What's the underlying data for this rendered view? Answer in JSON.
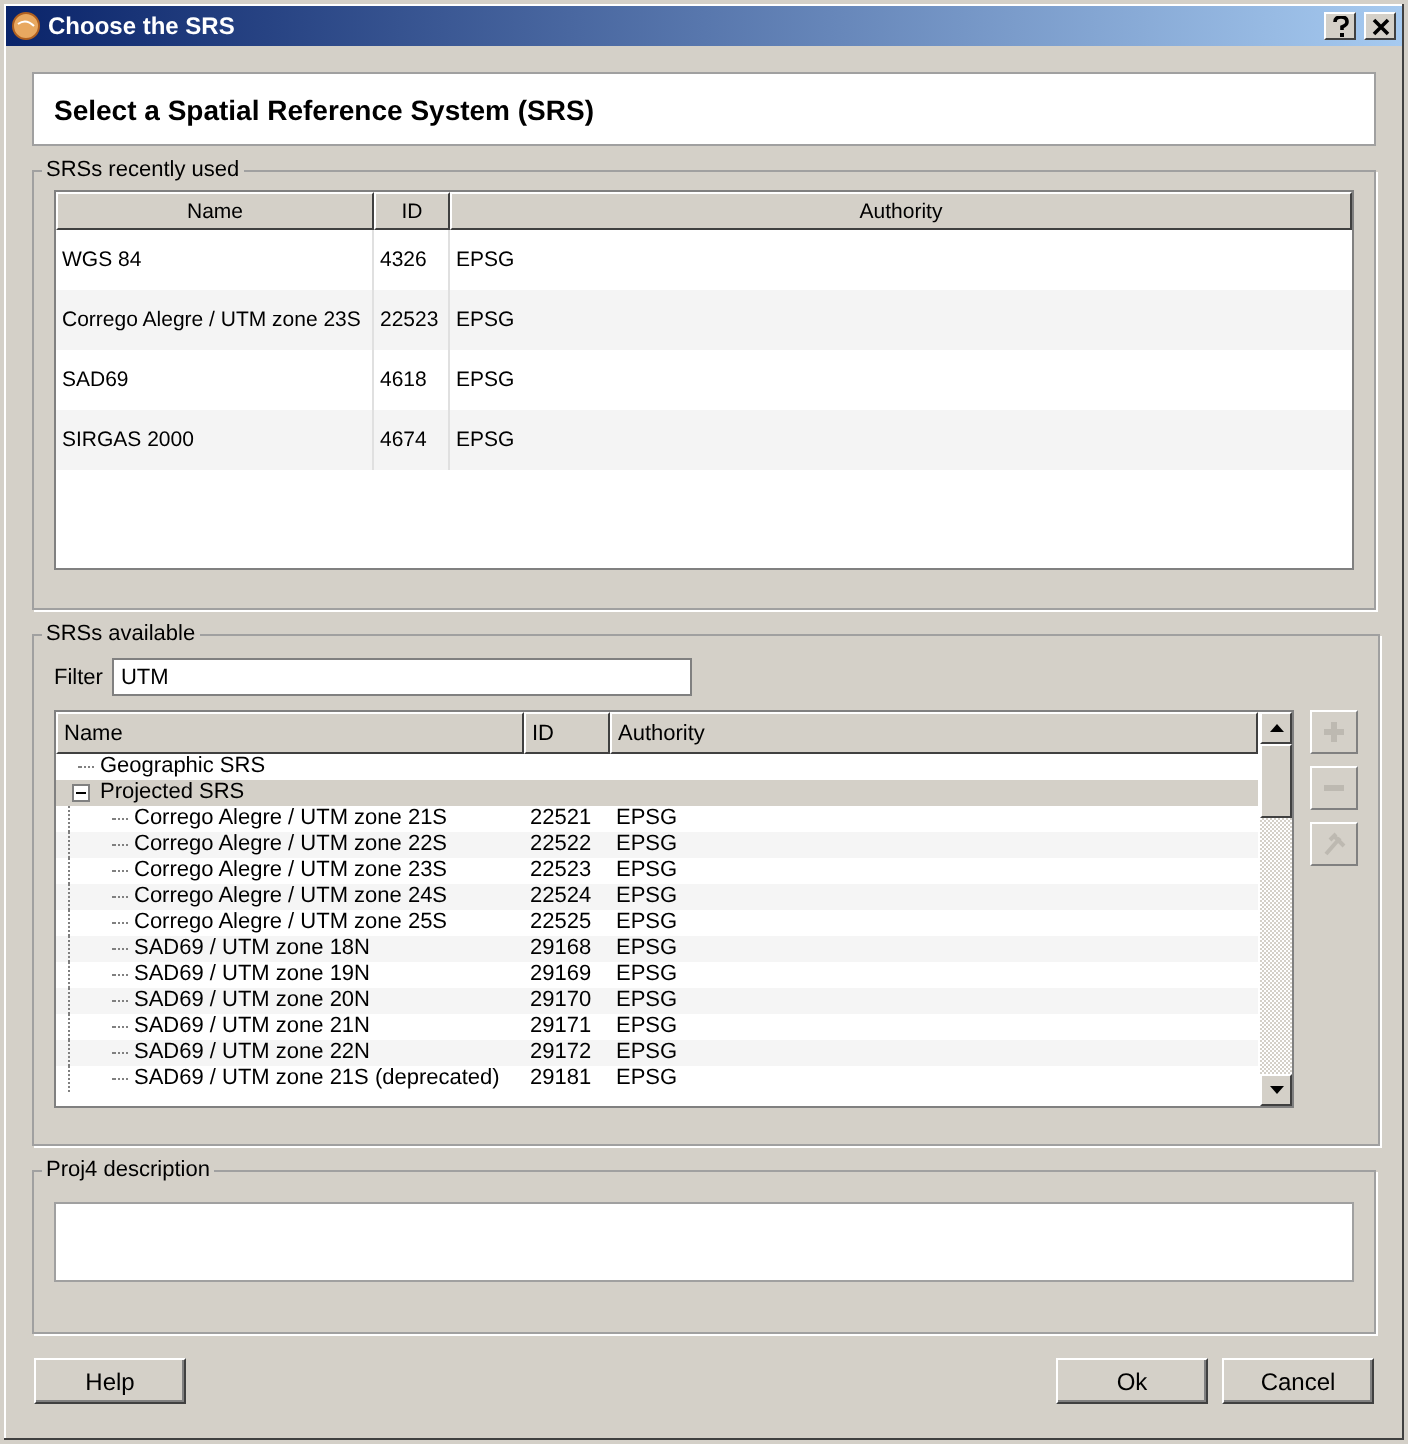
{
  "window": {
    "title": "Choose the SRS"
  },
  "header": "Select a Spatial Reference System (SRS)",
  "recent": {
    "title": "SRSs recently used",
    "columns": [
      "Name",
      "ID",
      "Authority"
    ],
    "rows": [
      {
        "name": "WGS 84",
        "id": "4326",
        "authority": "EPSG"
      },
      {
        "name": "Corrego Alegre / UTM zone 23S",
        "id": "22523",
        "authority": "EPSG"
      },
      {
        "name": "SAD69",
        "id": "4618",
        "authority": "EPSG"
      },
      {
        "name": "SIRGAS 2000",
        "id": "4674",
        "authority": "EPSG"
      }
    ]
  },
  "available": {
    "title": "SRSs available",
    "filter_label": "Filter",
    "filter_value": "UTM",
    "columns": [
      "Name",
      "ID",
      "Authority"
    ],
    "tree": [
      {
        "name": "Geographic SRS",
        "selected": false
      },
      {
        "name": "Projected SRS",
        "selected": true,
        "expanded": true,
        "children": [
          {
            "name": "Corrego Alegre / UTM zone 21S",
            "id": "22521",
            "authority": "EPSG",
            "selected": false
          },
          {
            "name": "Corrego Alegre / UTM zone 22S",
            "id": "22522",
            "authority": "EPSG",
            "selected": false
          },
          {
            "name": "Corrego Alegre / UTM zone 23S",
            "id": "22523",
            "authority": "EPSG",
            "selected": false
          },
          {
            "name": "Corrego Alegre / UTM zone 24S",
            "id": "22524",
            "authority": "EPSG",
            "selected": false
          },
          {
            "name": "Corrego Alegre / UTM zone 25S",
            "id": "22525",
            "authority": "EPSG",
            "selected": false
          },
          {
            "name": "SAD69 / UTM zone 18N",
            "id": "29168",
            "authority": "EPSG",
            "selected": false
          },
          {
            "name": "SAD69 / UTM zone 19N",
            "id": "29169",
            "authority": "EPSG",
            "selected": false
          },
          {
            "name": "SAD69 / UTM zone 20N",
            "id": "29170",
            "authority": "EPSG",
            "selected": false
          },
          {
            "name": "SAD69 / UTM zone 21N",
            "id": "29171",
            "authority": "EPSG",
            "selected": false
          },
          {
            "name": "SAD69 / UTM zone 22N",
            "id": "29172",
            "authority": "EPSG",
            "selected": false
          },
          {
            "name": "SAD69 / UTM zone 21S (deprecated)",
            "id": "29181",
            "authority": "EPSG",
            "selected": false
          }
        ]
      }
    ],
    "side_buttons": [
      {
        "kind": "add",
        "disabled": true
      },
      {
        "kind": "remove",
        "disabled": true
      },
      {
        "kind": "edit",
        "disabled": true
      }
    ]
  },
  "proj4": {
    "title": "Proj4 description"
  },
  "buttons": {
    "help": "Help",
    "ok": "Ok",
    "cancel": "Cancel"
  }
}
